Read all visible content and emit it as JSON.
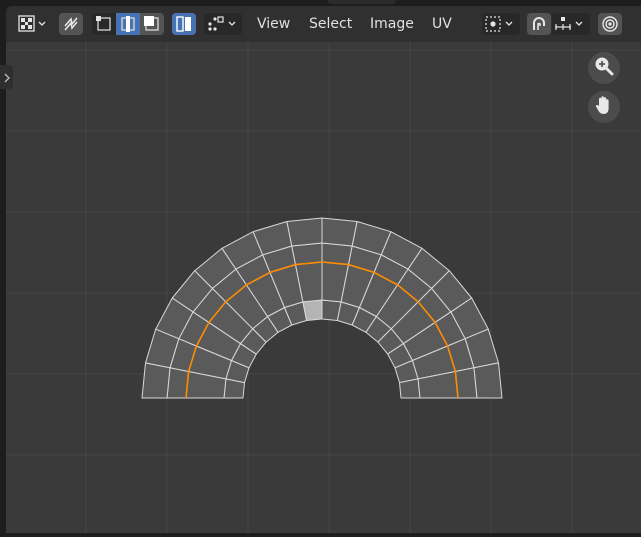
{
  "header": {
    "editor_type_icon": "uv-editor-icon",
    "sync_selection_icon": "sync-selection-icon",
    "select_modes": [
      "vertex-select-icon",
      "edge-select-icon",
      "face-select-icon"
    ],
    "island_mode_icon": "island-select-icon",
    "sticky_mode_icon": "sticky-selection-icon",
    "menus": [
      "View",
      "Select",
      "Image",
      "UV"
    ],
    "pivot_icon": "pivot-point-icon",
    "snap_icon": "snap-icon",
    "snap_target_icon": "snap-increment-icon",
    "proportional_icon": "proportional-editing-icon"
  },
  "viewport": {
    "grid_color": "#474747",
    "background": "#3a3a3a",
    "mesh": {
      "face_fill": "#5a5a5a",
      "edge_color": "#d8d8d8",
      "seam_color": "#ff8c00",
      "selected_face_fill": "#b4b4b4",
      "segments": 16,
      "rings": 4,
      "seam_ring": 2,
      "selected_face": {
        "segment": 7,
        "ring": 0
      }
    }
  },
  "navigation": {
    "zoom_icon": "zoom-icon",
    "pan_icon": "hand-pan-icon"
  },
  "colors": {
    "accent": "#4772b3",
    "header_bg": "#303030",
    "button_bg": "#545454"
  }
}
